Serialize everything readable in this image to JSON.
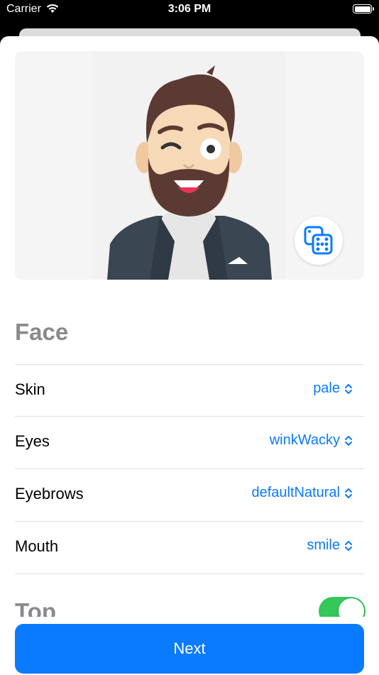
{
  "status_bar": {
    "carrier": "Carrier",
    "time": "3:06 PM"
  },
  "face_section": {
    "title": "Face",
    "rows": [
      {
        "label": "Skin",
        "value": "pale"
      },
      {
        "label": "Eyes",
        "value": "winkWacky"
      },
      {
        "label": "Eyebrows",
        "value": "defaultNatural"
      },
      {
        "label": "Mouth",
        "value": "smile"
      }
    ]
  },
  "top_section": {
    "title": "Top",
    "toggle_on": true
  },
  "next_button": {
    "label": "Next"
  },
  "colors": {
    "accent": "#0a7aff",
    "toggle": "#34c759",
    "section_title": "#8a8a8e"
  },
  "icons": {
    "randomize": "dice-icon",
    "wifi": "wifi-icon",
    "battery": "battery-icon",
    "picker": "chevron-up-down-icon"
  }
}
